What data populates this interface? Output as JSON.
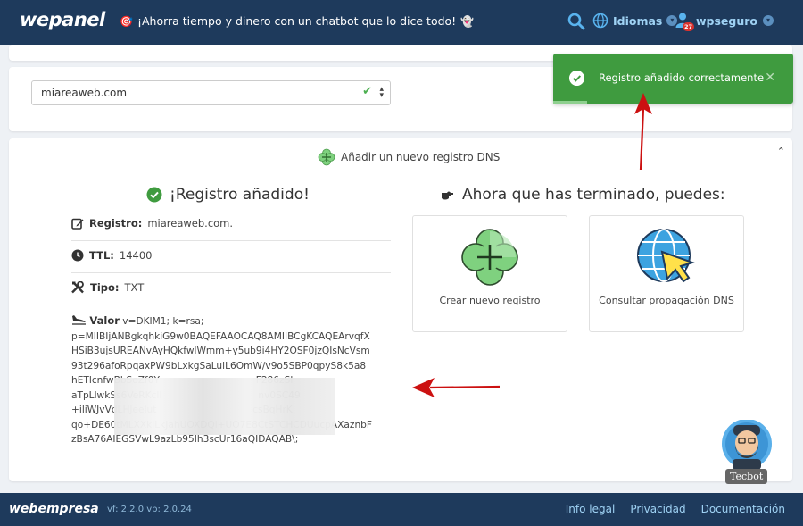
{
  "header": {
    "logo": "wepanel",
    "promo_text": "¡Ahorra tiempo y dinero con un chatbot que lo dice todo!",
    "languages_label": "Idiomas",
    "username": "wpseguro",
    "notification_count": "27"
  },
  "domain_select": {
    "value": "miareaweb.com"
  },
  "add_record": {
    "header_label": "Añadir un nuevo registro DNS"
  },
  "result": {
    "title": "¡Registro añadido!",
    "registro_label": "Registro:",
    "registro_value": "miareaweb.com.",
    "ttl_label": "TTL:",
    "ttl_value": "14400",
    "tipo_label": "Tipo:",
    "tipo_value": "TXT",
    "valor_label": "Valor",
    "valor_lines": [
      "v=DKIM1; k=rsa;",
      "p=MIIBIjANBgkqhkiG9w0BAQEFAAOCAQ8AMIIBCgKCAQEArvqfX",
      "HSiB3ujsUREANvAyHQkfwlWmm+y5ub9i4HY2OSF0jzQIsNcVsm",
      "93t296afoRpqaxPW9bLxkgSaLuiL6OmW/v9o5SBP0qpyS8k5a8",
      "hETlcnfwBbSoZf0Y                                F286zSl",
      "aTpLlwkSs6VeRKcII                                nv0SC49",
      "+iliWJvVdLHJeelut                                csBqHrK",
      "qo+DE60tMLXXkiLkJahUOXDQl+UO7E8CtSTCHCDUucpAXaznbF",
      "zBsA76AIEGSVwL9azLb95Ih3scUr16aQIDAQAB\\;"
    ]
  },
  "next_steps": {
    "title": "Ahora que has terminado, puedes:",
    "option_create": "Crear nuevo registro",
    "option_propagation": "Consultar propagación DNS"
  },
  "toast": {
    "message": "Registro añadido correctamente",
    "progress": 0.14
  },
  "tecbot": {
    "label": "Tecbot"
  },
  "footer": {
    "logo": "webempresa",
    "version": "vf: 2.2.0 vb: 2.0.24",
    "links": [
      "Info legal",
      "Privacidad",
      "Documentación"
    ]
  },
  "colors": {
    "header_bg": "#1e3a5c",
    "accent_link": "#9fd2f4",
    "success": "#3f9b3f",
    "arrow": "#cc1111"
  }
}
